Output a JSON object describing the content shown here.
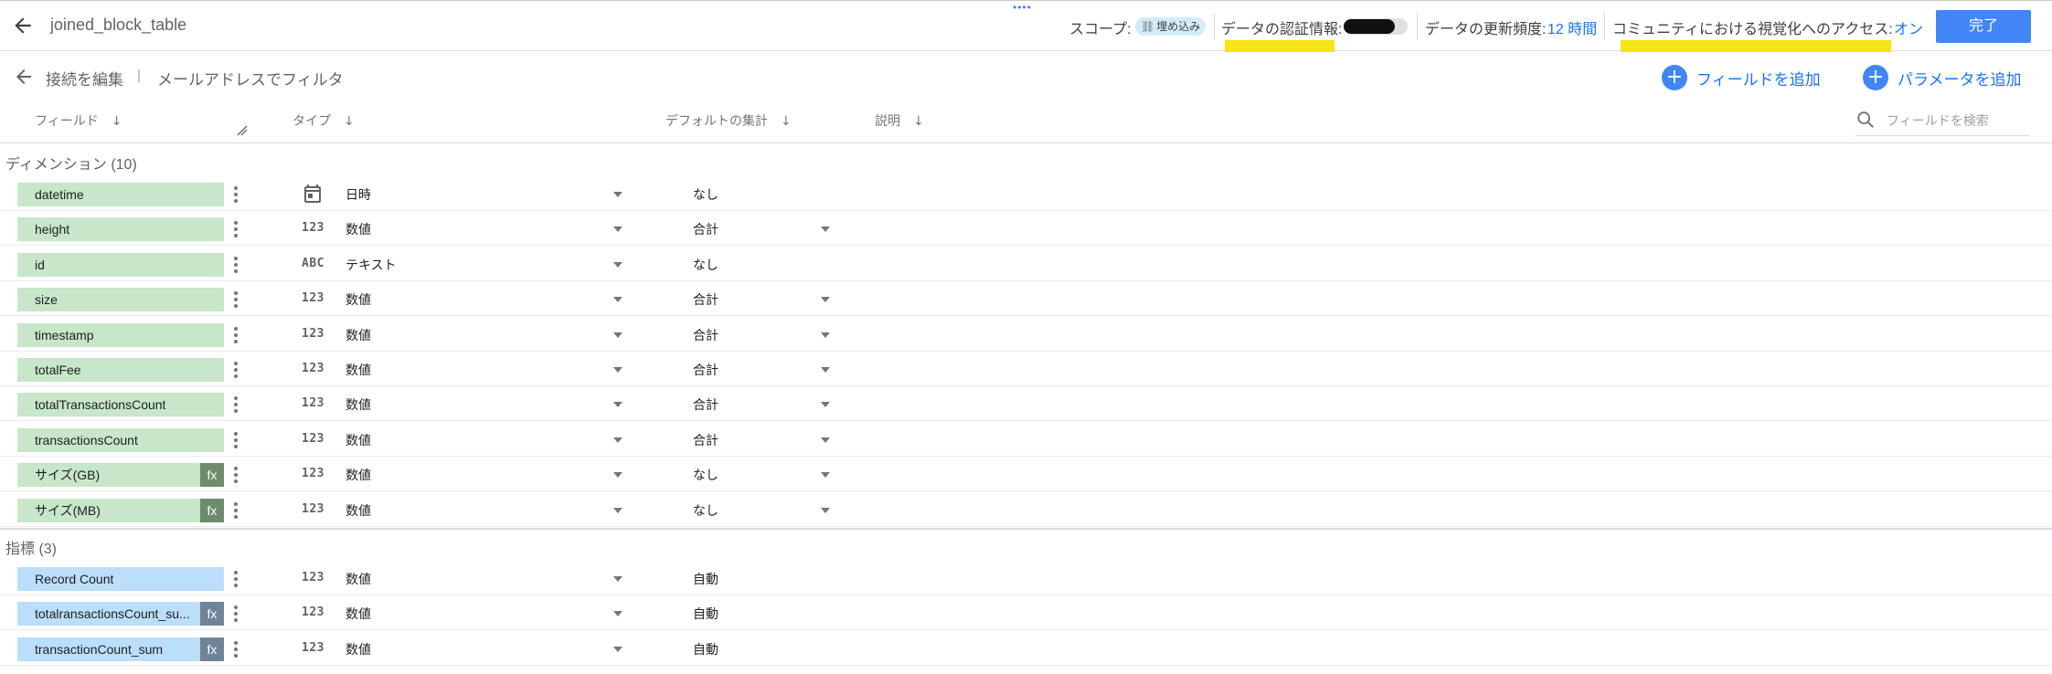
{
  "header": {
    "title": "joined_block_table",
    "scope_label": "スコープ:",
    "scope_value": "埋め込み",
    "credentials_label": "データの認証情報:",
    "refresh_label": "データの更新頻度:",
    "refresh_value": "12 時間",
    "community_label": "コミュニティにおける視覚化へのアクセス:",
    "community_value": "オン",
    "done_label": "完了"
  },
  "subbar": {
    "edit_connection": "接続を編集",
    "separator": "|",
    "filter_by_email": "メールアドレスでフィルタ",
    "add_field": "フィールドを追加",
    "add_parameter": "パラメータを追加"
  },
  "columns": {
    "field": "フィールド",
    "type": "タイプ",
    "default_agg": "デフォルトの集計",
    "description": "説明",
    "sort_arrow": "↓"
  },
  "search": {
    "placeholder": "フィールドを検索"
  },
  "dimensions": {
    "title": "ディメンション (10)",
    "rows": [
      {
        "name": "datetime",
        "type_icon": "calendar-icon",
        "type": "日時",
        "agg": "なし",
        "fx": false,
        "agg_dropdown": false
      },
      {
        "name": "height",
        "type_icon": "123",
        "type": "数値",
        "agg": "合計",
        "fx": false,
        "agg_dropdown": true
      },
      {
        "name": "id",
        "type_icon": "ABC",
        "type": "テキスト",
        "agg": "なし",
        "fx": false,
        "agg_dropdown": false
      },
      {
        "name": "size",
        "type_icon": "123",
        "type": "数値",
        "agg": "合計",
        "fx": false,
        "agg_dropdown": true
      },
      {
        "name": "timestamp",
        "type_icon": "123",
        "type": "数値",
        "agg": "合計",
        "fx": false,
        "agg_dropdown": true
      },
      {
        "name": "totalFee",
        "type_icon": "123",
        "type": "数値",
        "agg": "合計",
        "fx": false,
        "agg_dropdown": true
      },
      {
        "name": "totalTransactionsCount",
        "type_icon": "123",
        "type": "数値",
        "agg": "合計",
        "fx": false,
        "agg_dropdown": true
      },
      {
        "name": "transactionsCount",
        "type_icon": "123",
        "type": "数値",
        "agg": "合計",
        "fx": false,
        "agg_dropdown": true
      },
      {
        "name": "サイズ(GB)",
        "type_icon": "123",
        "type": "数値",
        "agg": "なし",
        "fx": true,
        "fx_label": "fx",
        "agg_dropdown": true
      },
      {
        "name": "サイズ(MB)",
        "type_icon": "123",
        "type": "数値",
        "agg": "なし",
        "fx": true,
        "fx_label": "fx",
        "agg_dropdown": true
      }
    ]
  },
  "metrics": {
    "title": "指標 (3)",
    "rows": [
      {
        "name": "Record Count",
        "type_icon": "123",
        "type": "数値",
        "agg": "自動",
        "fx": false,
        "agg_dropdown": false
      },
      {
        "name": "totalransactionsCount_su...",
        "type_icon": "123",
        "type": "数値",
        "agg": "自動",
        "fx": true,
        "fx_label": "fx",
        "agg_dropdown": false
      },
      {
        "name": "transactionCount_sum",
        "type_icon": "123",
        "type": "数値",
        "agg": "自動",
        "fx": true,
        "fx_label": "fx",
        "agg_dropdown": false
      }
    ]
  },
  "colors": {
    "accent": "#4285f4",
    "link": "#1a73e8",
    "dimension_chip": "#c8e6c9",
    "metric_chip": "#bbdefb",
    "highlight": "#f7e414"
  }
}
